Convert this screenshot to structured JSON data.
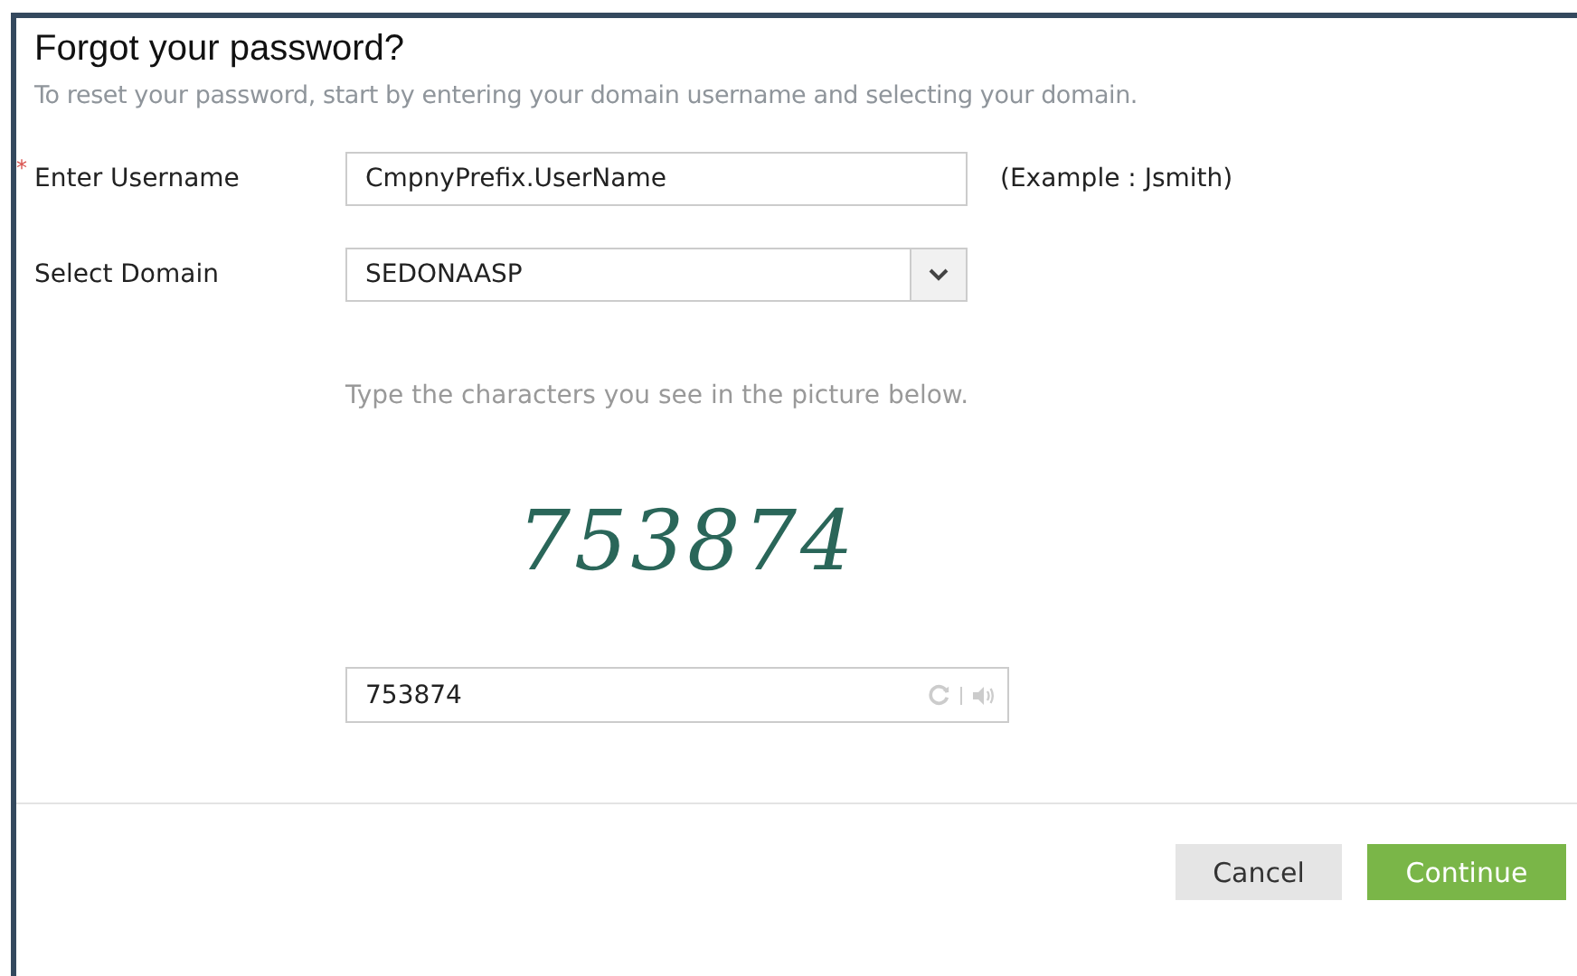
{
  "dialog": {
    "title": "Forgot your password?",
    "subtitle": "To reset your password, start by entering your domain username and selecting your domain."
  },
  "fields": [
    {
      "kind": "text",
      "label": "Enter Username",
      "required_mark": "*",
      "value": "CmpnyPrefix.UserName",
      "hint": "(Example : Jsmith)"
    },
    {
      "kind": "select",
      "label": "Select Domain",
      "value": "SEDONAASP"
    }
  ],
  "captcha": {
    "instruction": "Type the characters you see in the picture below.",
    "characters": "753874",
    "value": "753874"
  },
  "buttons": [
    {
      "label": "Cancel",
      "kind": "secondary"
    },
    {
      "label": "Continue",
      "kind": "primary"
    }
  ]
}
